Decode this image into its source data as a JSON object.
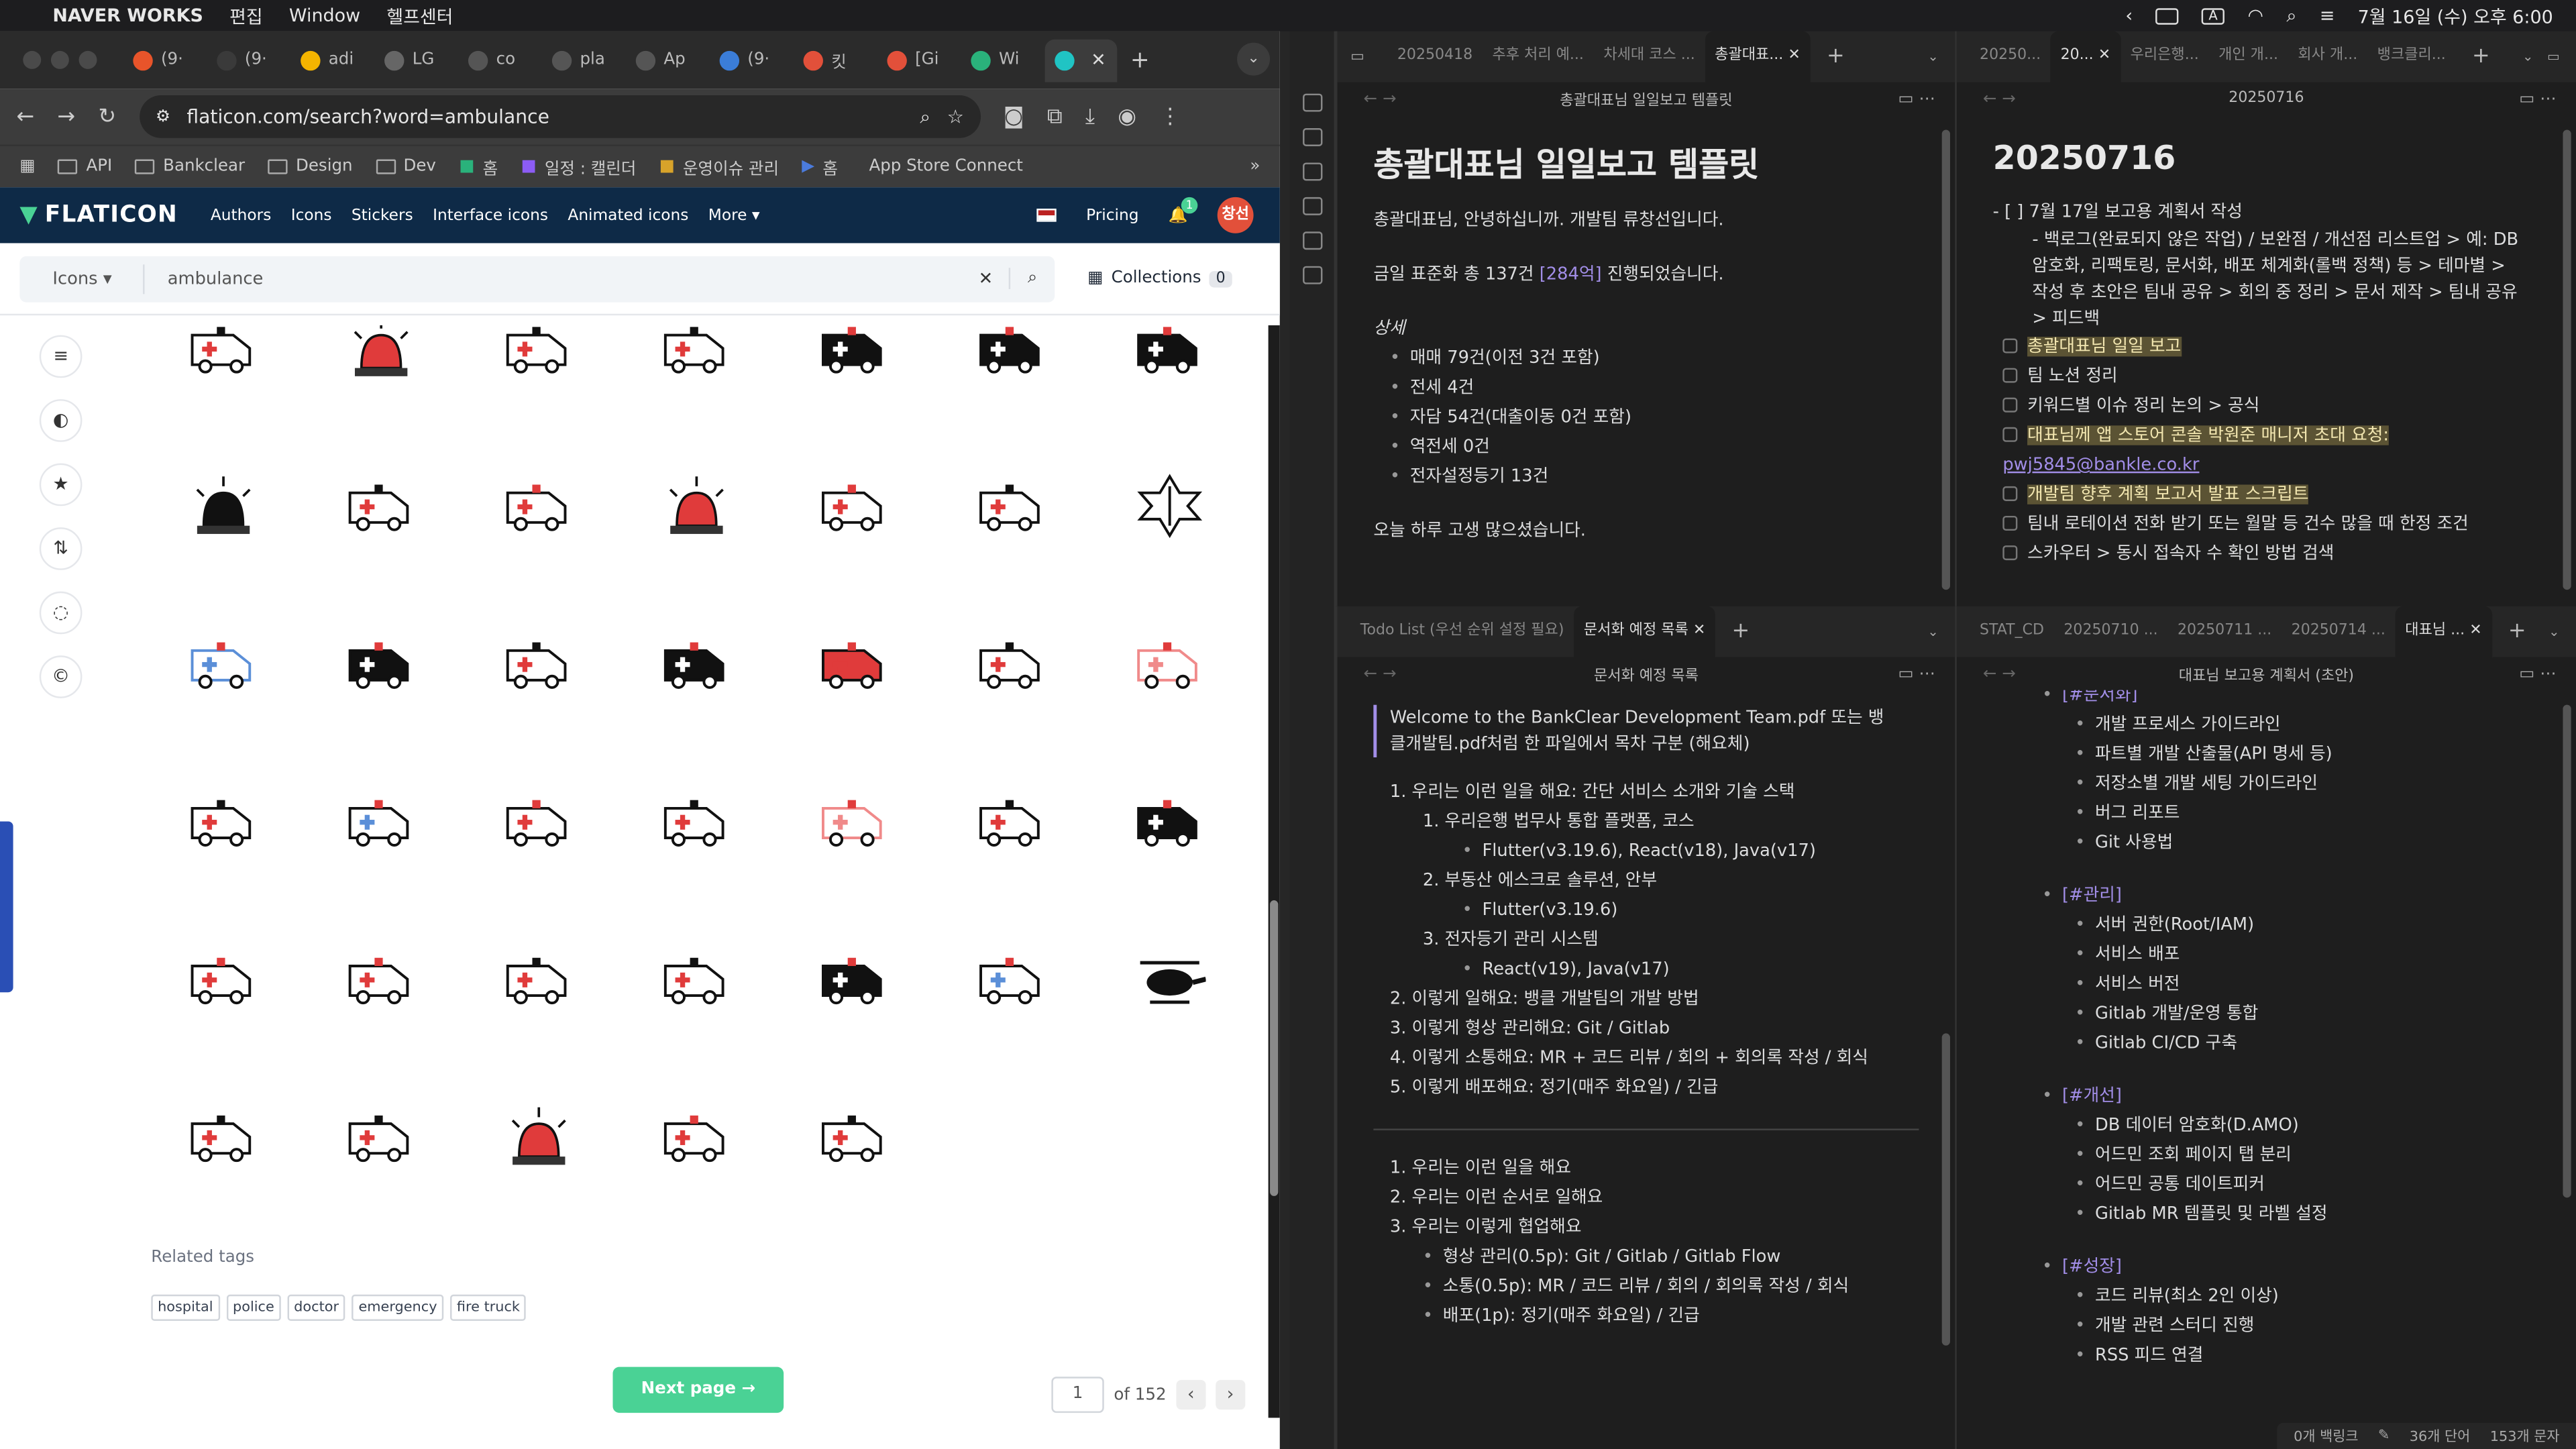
{
  "menubar": {
    "app": "NAVER WORKS",
    "menus": [
      "편집",
      "Window",
      "헬프센터"
    ],
    "datetime": "7월 16일 (수) 오후 6:00"
  },
  "chrome": {
    "tabs": [
      {
        "label": "(9·",
        "color": "#e8542a"
      },
      {
        "label": "(9·",
        "color": "#3a3a3a"
      },
      {
        "label": "adi",
        "color": "#f4b400"
      },
      {
        "label": "LG",
        "color": "#666"
      },
      {
        "label": "co",
        "color": "#555"
      },
      {
        "label": "pla",
        "color": "#555"
      },
      {
        "label": "Ap",
        "color": "#555"
      },
      {
        "label": "(9·",
        "color": "#3b7dd8"
      },
      {
        "label": "킷",
        "color": "#e2503a"
      },
      {
        "label": "[Gi",
        "color": "#e2503a"
      },
      {
        "label": "Wi",
        "color": "#2ab27b"
      },
      {
        "label": "",
        "color": "#20c4c4"
      }
    ],
    "url": "flaticon.com/search?word=ambulance",
    "bookmarks": [
      "API",
      "Bankclear",
      "Design",
      "Dev",
      "홈",
      "일정 : 캘린더",
      "운영이슈 관리",
      "홈",
      "App Store Connect"
    ]
  },
  "flaticon": {
    "logo": "FLATICON",
    "nav": [
      "Authors",
      "Icons",
      "Stickers",
      "Interface icons",
      "Animated icons",
      "More"
    ],
    "pricing": "Pricing",
    "notif_count": "1",
    "avatar": "창선",
    "search_type": "Icons",
    "search_query": "ambulance",
    "collections_label": "Collections",
    "collections_count": "0",
    "related_label": "Related tags",
    "tags": [
      "hospital",
      "police",
      "doctor",
      "emergency",
      "fire truck"
    ],
    "next_page": "Next page",
    "page_current": "1",
    "page_total": "of 152",
    "icons": [
      "ambulance-icon",
      "siren-icon",
      "ambulance-outline-icon",
      "bus-front-icon",
      "ambulance-circle-icon",
      "ambulance-black-icon",
      "ambulance-side-icon",
      "alarm-light-icon",
      "ambulance-line-icon",
      "ambulance-round-icon",
      "hand-siren-icon",
      "ambulance-color-icon",
      "van-icon",
      "caduceus-icon",
      "ambulance-blue-icon",
      "ambulance-phone-icon",
      "ambulance-star-icon",
      "ambulance-black-long-icon",
      "ambulance-red-icon",
      "ambulance-flat-icon",
      "ambulance-pink-icon",
      "ambulance-speed-icon",
      "ambulance-cloud-icon",
      "ambulance-color-2-icon",
      "ambulance-outline-2-icon",
      "ambulance-pink-line-icon",
      "ambulance-alert-icon",
      "ambulance-solid-icon",
      "ambulance-small-icon",
      "ambulance-fast-icon",
      "ambulance-front-icon",
      "ambulance-light-icon",
      "ambulance-glyph-icon",
      "ambulance-hospital-icon",
      "helicopter-icon",
      "ambulance-call-icon",
      "ambulance-simple-icon",
      "siren-cross-icon",
      "ambulance-3d-icon",
      "ambulance-thin-icon"
    ]
  },
  "obsidian": {
    "top_left_tabs": [
      "20250418",
      "추후 처리 예...",
      "차세대 코스 ...",
      "총괄대표..."
    ],
    "top_left_title": "총괄대표님 일일보고 템플릿",
    "doc1": {
      "h1": "총괄대표님 일일보고 템플릿",
      "greeting": "총괄대표님, 안녕하십니까. 개발팀 류창선입니다.",
      "summary_a": "금일 표준화 총 137건 ",
      "summary_b": "[284억]",
      "summary_c": " 진행되었습니다.",
      "detail_label": "상세",
      "items": [
        "매매 79건(이전 3건 포함)",
        "전세 4건",
        "자담 54건(대출이동 0건 포함)",
        "역전세 0건",
        "전자설정등기 13건"
      ],
      "closing": "오늘 하루 고생 많으셨습니다."
    },
    "top_right_tabs": [
      "20250...",
      "20...",
      "우리은행...",
      "개인 개...",
      "회사 개...",
      "뱅크클리..."
    ],
    "top_right_title": "20250716",
    "doc2": {
      "h1": "20250716",
      "task1": "7월 17일 보고용 계획서 작성",
      "task1_sub": "백로그(완료되지 않은 작업) / 보완점 / 개선점 리스트업 > 예: DB 암호화, 리팩토링, 문서화, 배포 체계화(롤백 정책) 등 > 테마별 > 작성 후 초안은 팀내 공유 > 회의 중 정리 > 문서 제작 > 팀내 공유 > 피드백",
      "todos": [
        {
          "text": "총괄대표님 일일 보고",
          "highlight": true
        },
        {
          "text": "팀 노션 정리",
          "highlight": false
        },
        {
          "text": "키워드별 이슈 정리 논의 > 공식",
          "highlight": false
        },
        {
          "text": "대표님께 앱 스토어 콘솔 박원준 매니저 초대 요청: ",
          "highlight": true,
          "link": "pwj5845@bankle.co.kr"
        },
        {
          "text": "개발팀 향후 계획 보고서 발표 스크립트",
          "highlight": true
        },
        {
          "text": "팀내 로테이션 전화 받기 또는 월말 등 건수 많을 때 한정 조건",
          "highlight": false
        },
        {
          "text": "스카우터 > 동시 접속자 수 확인 방법 검색",
          "highlight": false
        }
      ]
    },
    "bottom_left_tabs": [
      "Todo List (우선 순위 설정 필요)",
      "문서화 예정 목록"
    ],
    "bottom_left_title": "문서화 예정 목록",
    "doc3": {
      "intro": "Welcome to the BankClear Development Team.pdf 또는 뱅클개발팀.pdf처럼 한 파일에서 목차 구분 (해요체)",
      "items": [
        "1. 우리는 이런 일을 해요: 간단 서비스 소개와 기술 스택",
        "1. 우리은행 법무사 통합 플랫폼, 코스",
        "Flutter(v3.19.6), React(v18), Java(v17)",
        "2. 부동산 에스크로 솔루션, 안부",
        "Flutter(v3.19.6)",
        "3. 전자등기 관리 시스템",
        "React(v19), Java(v17)",
        "2. 이렇게 일해요: 뱅클 개발팀의 개발 방법",
        "3. 이렇게 형상 관리해요: Git / Gitlab",
        "4. 이렇게 소통해요: MR + 코드 리뷰 / 회의 + 회의록 작성 / 회식",
        "5. 이렇게 배포해요: 정기(매주 화요일) / 긴급"
      ],
      "items2": [
        "1. 우리는 이런 일을 해요",
        "2. 우리는 이런 순서로 일해요",
        "3. 우리는 이렇게 협업해요",
        "형상 관리(0.5p): Git / Gitlab / Gitlab Flow",
        "소통(0.5p): MR / 코드 리뷰 / 회의 / 회의록 작성 / 회식",
        "배포(1p): 정기(매주 화요일) / 긴급"
      ]
    },
    "bottom_right_tabs": [
      "STAT_CD",
      "20250710 ...",
      "20250711 ...",
      "20250714 ...",
      "대표님 ..."
    ],
    "bottom_right_title": "대표님 보고용 계획서 (초안)",
    "doc4": {
      "sections": [
        {
          "tag": "[#문서화]",
          "items": [
            "개발 프로세스 가이드라인",
            "파트별 개발 산출물(API 명세 등)",
            "저장소별 개발 세팅 가이드라인",
            "버그 리포트",
            "Git 사용법"
          ]
        },
        {
          "tag": "[#관리]",
          "items": [
            "서버 권한(Root/IAM)",
            "서비스 배포",
            "서비스 버전",
            "Gitlab 개발/운영 통합",
            "Gitlab CI/CD 구축"
          ]
        },
        {
          "tag": "[#개선]",
          "items": [
            "DB 데이터 암호화(D.AMO)",
            "어드민 조회 페이지 탭 분리",
            "어드민 공통 데이트피커",
            "Gitlab MR 템플릿 및 라벨 설정"
          ]
        },
        {
          "tag": "[#성장]",
          "items": [
            "코드 리뷰(최소 2인 이상)",
            "개발 관련 스터디 진행",
            "RSS 피드 연결"
          ]
        }
      ]
    },
    "status": {
      "backlinks": "0개 백링크",
      "words": "36개 단어",
      "chars": "153개 문자"
    }
  }
}
